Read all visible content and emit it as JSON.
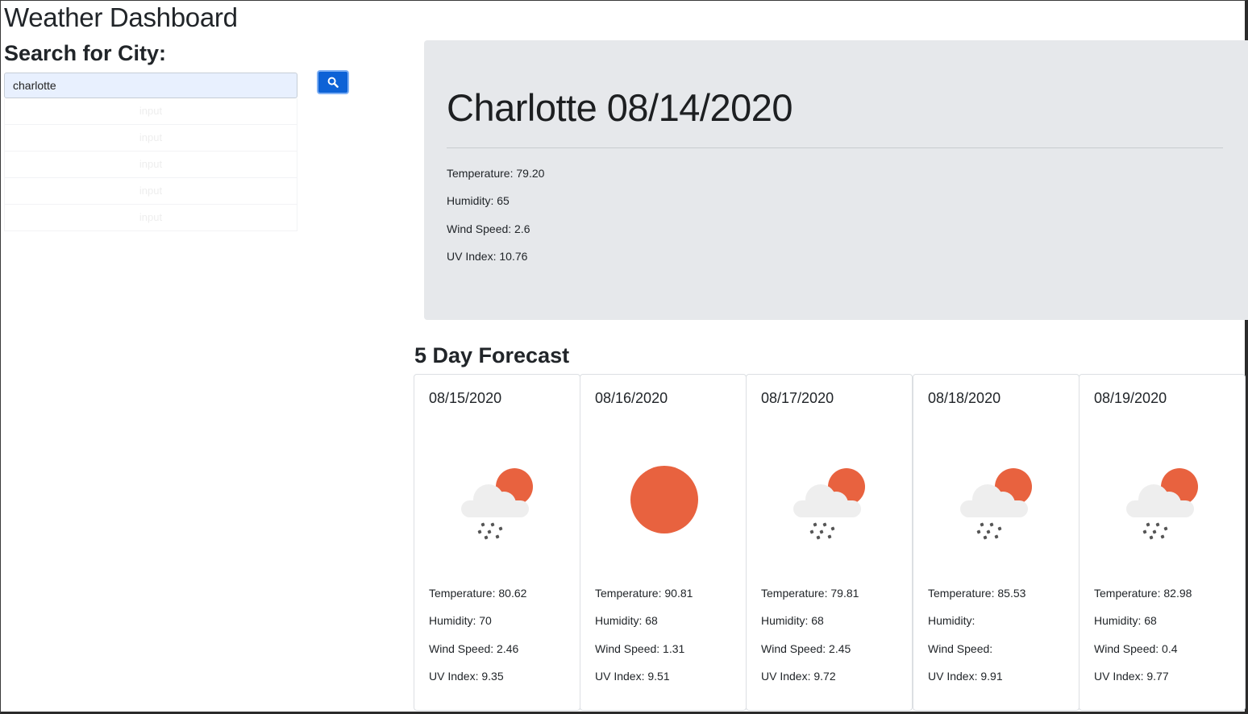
{
  "app": {
    "title": "Weather Dashboard",
    "search_label": "Search for City:",
    "search_value": "charlotte",
    "search_icon": "search-icon"
  },
  "history": [
    "input",
    "input",
    "input",
    "input",
    "input"
  ],
  "current": {
    "title": "Charlotte 08/14/2020",
    "temperature": "Temperature: 79.20",
    "humidity": "Humidity: 65",
    "wind": "Wind Speed: 2.6",
    "uv": "UV Index: 10.76"
  },
  "forecast": {
    "title": "5 Day Forecast",
    "days": [
      {
        "date": "08/15/2020",
        "icon": "rain-sun-icon",
        "temperature": "Temperature: 80.62",
        "humidity": "Humidity: 70",
        "wind": "Wind Speed: 2.46",
        "uv": "UV Index: 9.35"
      },
      {
        "date": "08/16/2020",
        "icon": "sun-icon",
        "temperature": "Temperature: 90.81",
        "humidity": "Humidity: 68",
        "wind": "Wind Speed: 1.31",
        "uv": "UV Index: 9.51"
      },
      {
        "date": "08/17/2020",
        "icon": "rain-sun-icon",
        "temperature": "Temperature: 79.81",
        "humidity": "Humidity: 68",
        "wind": "Wind Speed: 2.45",
        "uv": "UV Index: 9.72"
      },
      {
        "date": "08/18/2020",
        "icon": "rain-sun-icon",
        "temperature": "Temperature: 85.53",
        "humidity": "Humidity:",
        "wind": "Wind Speed:",
        "uv": "UV Index: 9.91"
      },
      {
        "date": "08/19/2020",
        "icon": "rain-sun-icon",
        "temperature": "Temperature: 82.98",
        "humidity": "Humidity: 68",
        "wind": "Wind Speed: 0.4",
        "uv": "UV Index: 9.77"
      }
    ]
  },
  "colors": {
    "accent": "#0d62d6",
    "sun": "#e8623f",
    "cloud": "#eeeeee",
    "panel": "#e6e8eb"
  }
}
